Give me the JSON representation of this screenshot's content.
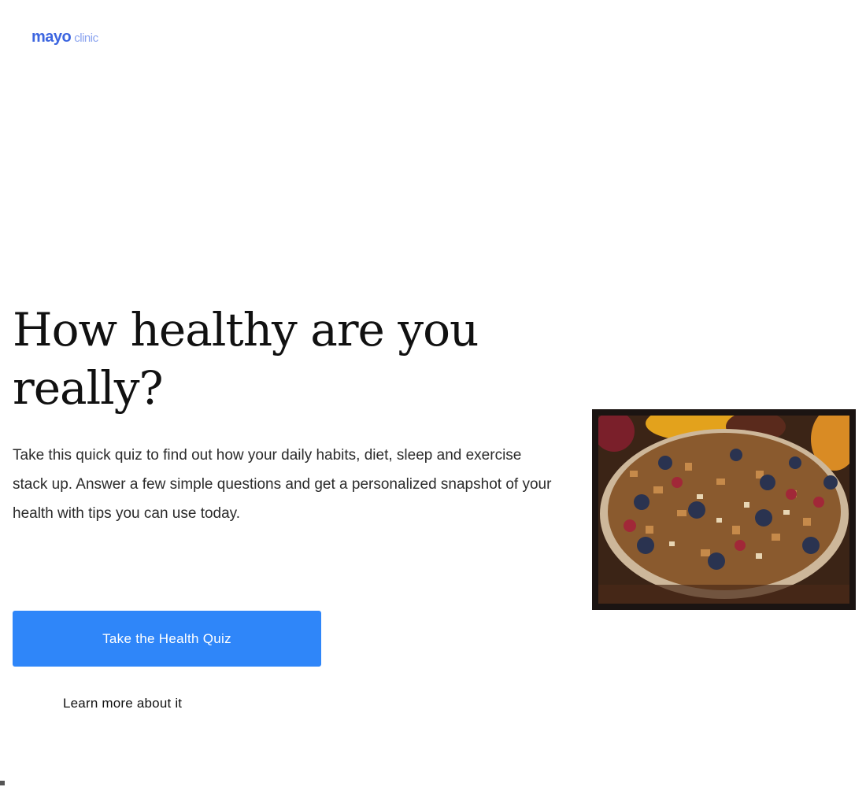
{
  "brand": {
    "name": "mayo",
    "suffix": "clinic"
  },
  "hero": {
    "title": "How healthy are you really?",
    "description": "Take this quick quiz to find out how your daily habits, diet, sleep and exercise stack up. Answer a few simple questions and get a personalized snapshot of your health with tips you can use today.",
    "primary_cta": "Take the Health Quiz",
    "secondary_link": "Learn more about it",
    "image_alt": "Bowl of granola with berries"
  },
  "colors": {
    "brand": "#3d66e0",
    "accent": "#2f86f9"
  }
}
